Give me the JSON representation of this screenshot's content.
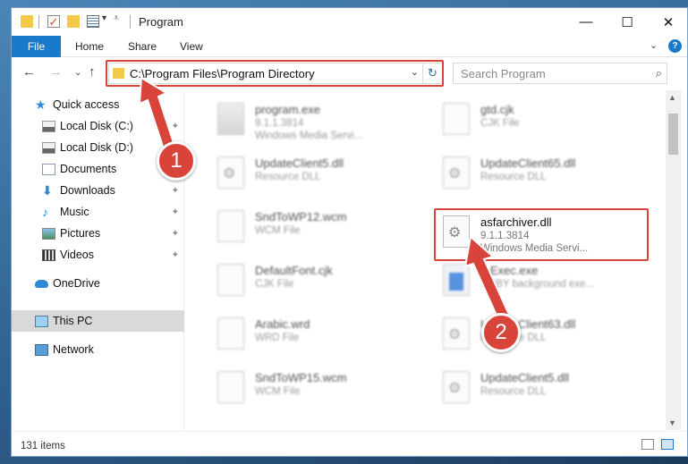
{
  "window": {
    "title": "Program",
    "minimize": "—",
    "maximize": "☐",
    "close": "✕"
  },
  "ribbon": {
    "tabs": [
      "File",
      "Home",
      "Share",
      "View"
    ],
    "expand": "⌄",
    "help": "?"
  },
  "address_bar": {
    "path": "C:\\Program Files\\Program Directory",
    "chevron": "⌄",
    "refresh": "↻"
  },
  "nav": {
    "back": "←",
    "forward": "→",
    "recent": "⌄",
    "up": "↑"
  },
  "search": {
    "placeholder": "Search Program",
    "icon": "⌕"
  },
  "sidebar": {
    "items": [
      {
        "label": "Quick access",
        "icon": "star-icon"
      },
      {
        "label": "Local Disk (C:)",
        "icon": "disk-icon",
        "pinned": true
      },
      {
        "label": "Local Disk (D:)",
        "icon": "disk-icon"
      },
      {
        "label": "Documents",
        "icon": "documents-icon",
        "pinned": true
      },
      {
        "label": "Downloads",
        "icon": "download-icon",
        "pinned": true
      },
      {
        "label": "Music",
        "icon": "music-icon",
        "pinned": true
      },
      {
        "label": "Pictures",
        "icon": "pictures-icon",
        "pinned": true
      },
      {
        "label": "Videos",
        "icon": "videos-icon",
        "pinned": true
      },
      {
        "label": "OneDrive",
        "icon": "cloud-icon"
      },
      {
        "label": "This PC",
        "icon": "pc-icon",
        "selected": true
      },
      {
        "label": "Network",
        "icon": "network-icon"
      }
    ],
    "pin_glyph": "📌"
  },
  "files": [
    {
      "name": "program.exe",
      "line1": "9.1.1.3814",
      "line2": "Windows Media Servi...",
      "kind": "exe",
      "blurred": true
    },
    {
      "name": "gtd.cjk",
      "line1": "CJK File",
      "line2": "",
      "kind": "file",
      "blurred": true
    },
    {
      "name": "UpdateClient5.dll",
      "line1": "Resource DLL",
      "line2": "",
      "kind": "dll",
      "blurred": true
    },
    {
      "name": "UpdateClient65.dll",
      "line1": "Resource DLL",
      "line2": "",
      "kind": "dll",
      "blurred": true
    },
    {
      "name": "SndToWP12.wcm",
      "line1": "WCM File",
      "line2": "",
      "kind": "file",
      "blurred": true
    },
    {
      "name": "asfarchiver.dll",
      "line1": "9.1.1.3814",
      "line2": "Windows Media Servi...",
      "kind": "dll",
      "blurred": false,
      "highlight": true
    },
    {
      "name": "DefaultFont.cjk",
      "line1": "CJK File",
      "line2": "",
      "kind": "file",
      "blurred": true
    },
    {
      "name": "...Exec.exe",
      "line1": "...BBY background exe...",
      "line2": "",
      "kind": "exe-blue",
      "blurred": true
    },
    {
      "name": "Arabic.wrd",
      "line1": "WRD File",
      "line2": "",
      "kind": "file",
      "blurred": true
    },
    {
      "name": "UpdateClient63.dll",
      "line1": "Resource DLL",
      "line2": "",
      "kind": "dll",
      "blurred": true
    },
    {
      "name": "SndToWP15.wcm",
      "line1": "WCM File",
      "line2": "",
      "kind": "file",
      "blurred": true
    },
    {
      "name": "UpdateClient5.dll",
      "line1": "Resource DLL",
      "line2": "",
      "kind": "dll",
      "blurred": true
    }
  ],
  "status": {
    "count": "131 items"
  },
  "annotations": {
    "badge1": "1",
    "badge2": "2"
  },
  "colors": {
    "accent": "#1979ca",
    "annotation": "#d9443a"
  }
}
